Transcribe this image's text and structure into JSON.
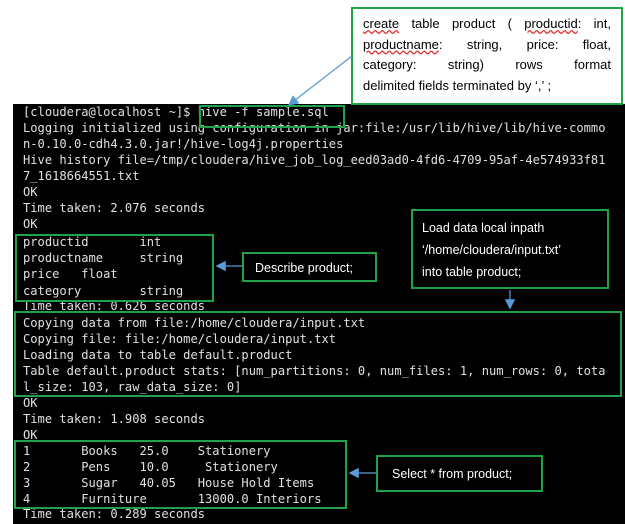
{
  "terminal": {
    "lines": [
      "[cloudera@localhost ~]$ hive -f sample.sql",
      "Logging initialized using configuration in jar:file:/usr/lib/hive/lib/hive-commo",
      "n-0.10.0-cdh4.3.0.jar!/hive-log4j.properties",
      "Hive history file=/tmp/cloudera/hive_job_log_eed03ad0-4fd6-4709-95af-4e574933f81",
      "7_1618664551.txt",
      "OK",
      "Time taken: 2.076 seconds",
      "OK",
      "productid       int",
      "productname     string",
      "price   float",
      "category        string",
      "Time taken: 0.626 seconds",
      "Copying data from file:/home/cloudera/input.txt",
      "Copying file: file:/home/cloudera/input.txt",
      "Loading data to table default.product",
      "Table default.product stats: [num_partitions: 0, num_files: 1, num_rows: 0, tota",
      "l_size: 103, raw_data_size: 0]",
      "OK",
      "Time taken: 1.908 seconds",
      "OK",
      "1       Books   25.0    Stationery",
      "2       Pens    10.0     Stationery",
      "3       Sugar   40.05   House Hold Items",
      "4       Furniture       13000.0 Interiors",
      "Time taken: 0.289 seconds"
    ]
  },
  "callouts": {
    "create_table": {
      "word_create": "create",
      "rest_line1": " table product ( ",
      "word_productid": "productid",
      "line1_end": ": int,",
      "word_productname": "productname",
      "line2_end": ": string, price: float,",
      "line3": "category: string) rows format",
      "line4": "delimited fields terminated by ‘,’ ;"
    },
    "load_data": {
      "line1": "Load data local inpath",
      "line2": "‘/home/cloudera/input.txt’",
      "line3": "into table product;"
    },
    "describe": {
      "text": "Describe product;"
    },
    "select": {
      "text": "Select * from product;"
    }
  },
  "colors": {
    "highlight_border": "#21a148",
    "arrow": "#5b9bd5",
    "terminal_bg": "#000000",
    "terminal_text": "#e0e0e0"
  }
}
